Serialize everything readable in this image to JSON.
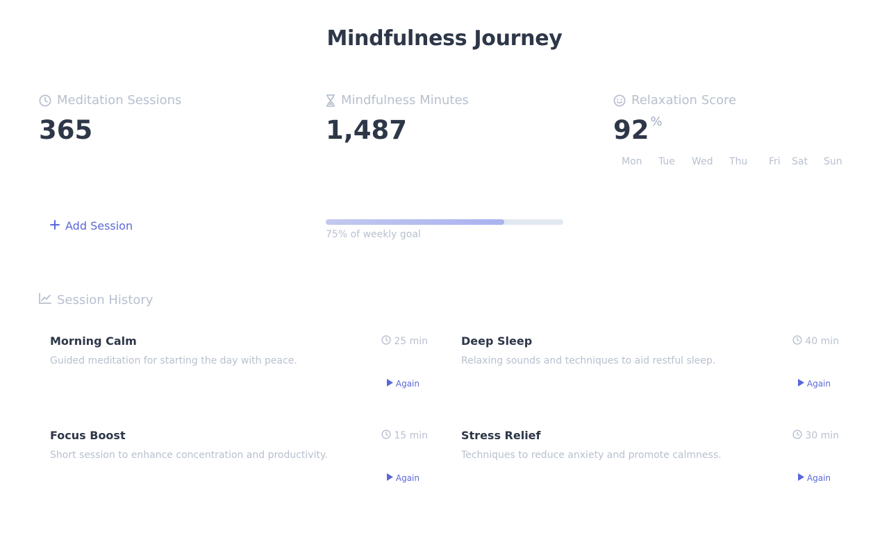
{
  "page_title": "Mindfulness Journey",
  "stats": {
    "sessions": {
      "label": "Meditation Sessions",
      "value": "365",
      "icon": "clock-icon"
    },
    "minutes": {
      "label": "Mindfulness Minutes",
      "value": "1,487",
      "icon": "hourglass-icon"
    },
    "relaxation": {
      "label": "Relaxation Score",
      "value": "92",
      "unit": "%",
      "icon": "smile-icon"
    }
  },
  "weekdays": [
    "Mon",
    "Tue",
    "Wed",
    "Thu",
    "Fri",
    "Sat",
    "Sun"
  ],
  "add_session_label": "Add Session",
  "weekly_goal": {
    "progress": 0.75,
    "label": "75% of weekly goal"
  },
  "history": {
    "title": "Session History",
    "items": [
      {
        "title": "Morning Calm",
        "duration": "25 min",
        "description": "Guided meditation for starting the day with peace.",
        "again_label": "Again"
      },
      {
        "title": "Deep Sleep",
        "duration": "40 min",
        "description": "Relaxing sounds and techniques to aid restful sleep.",
        "again_label": "Again"
      },
      {
        "title": "Focus Boost",
        "duration": "15 min",
        "description": "Short session to enhance concentration and productivity.",
        "again_label": "Again"
      },
      {
        "title": "Stress Relief",
        "duration": "30 min",
        "description": "Techniques to reduce anxiety and promote calmness.",
        "again_label": "Again"
      }
    ]
  },
  "colors": {
    "accent": "#5a67d8",
    "text": "#2d3748",
    "muted": "#b8c0cf"
  }
}
